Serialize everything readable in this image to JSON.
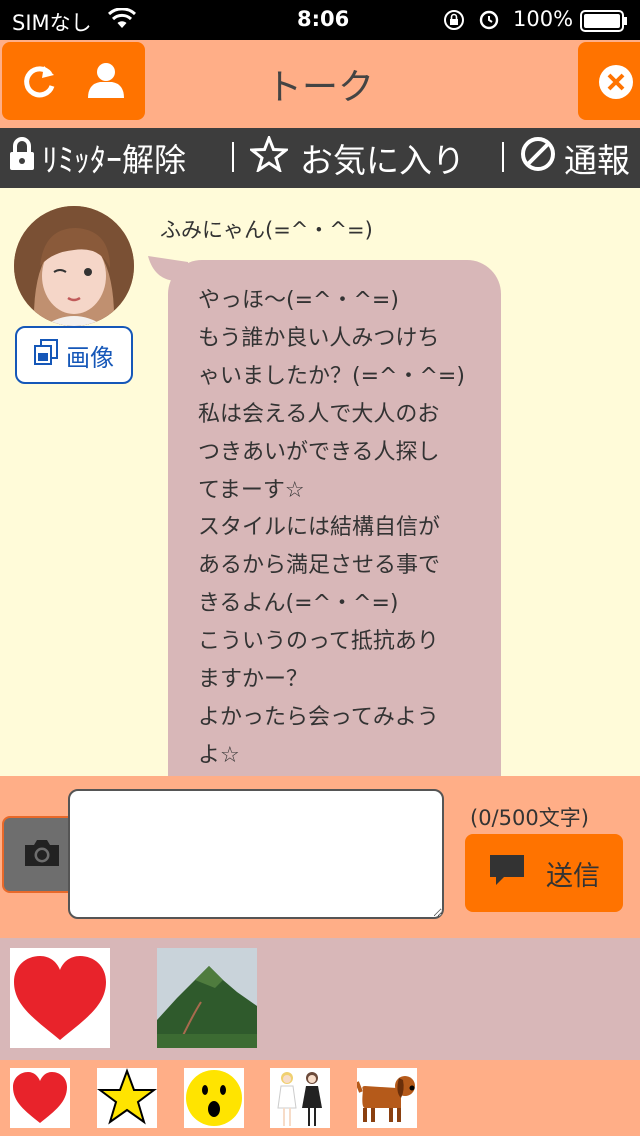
{
  "status_bar": {
    "carrier": "SIMなし",
    "time": "8:06",
    "battery": "100%"
  },
  "header": {
    "title": "トーク"
  },
  "toolbar": {
    "limiter_label": "ﾘﾐｯﾀｰ解除",
    "favorite_label": "お気に入り",
    "report_label": "通報"
  },
  "chat": {
    "sender_name": "ふみにゃん(=^・^=)",
    "image_button_label": "画像",
    "message_text": "やっほ〜(=^・^=)\nもう誰か良い人みつけち\nゃいましたか？(=^・^=)\n私は会える人で大人のお\nつきあいができる人探し\nてまーす☆\nスタイルには結構自信が\nあるから満足させる事で\nきるよん(=^・^=)\nこういうのって抵抗あり\nますかー？\nよかったら会ってみよう\nよ☆"
  },
  "input_bar": {
    "message_value": "",
    "char_counter": "(0/500文字)",
    "send_label": "送信"
  },
  "icons": {
    "refresh": "refresh-icon",
    "profile": "person-icon",
    "close": "close-icon",
    "lock": "lock-icon",
    "star": "star-icon",
    "prohibit": "prohibit-icon",
    "image": "image-icon",
    "camera": "camera-icon",
    "chat_bubble": "chat-bubble-icon"
  },
  "colors": {
    "accent_orange": "#ff7300",
    "header_bg": "#ffae87",
    "toolbar_bg": "#3d3d3d",
    "chat_bg": "#fffbd9",
    "bubble_bg": "#d8b7b8",
    "link_blue": "#1557b8"
  },
  "stamps": [
    "heart-stamp",
    "mountain-stamp"
  ],
  "emoji_palette": [
    "heart-emoji",
    "star-emoji",
    "surprised-face-emoji",
    "two-girls-emoji",
    "dog-emoji"
  ]
}
